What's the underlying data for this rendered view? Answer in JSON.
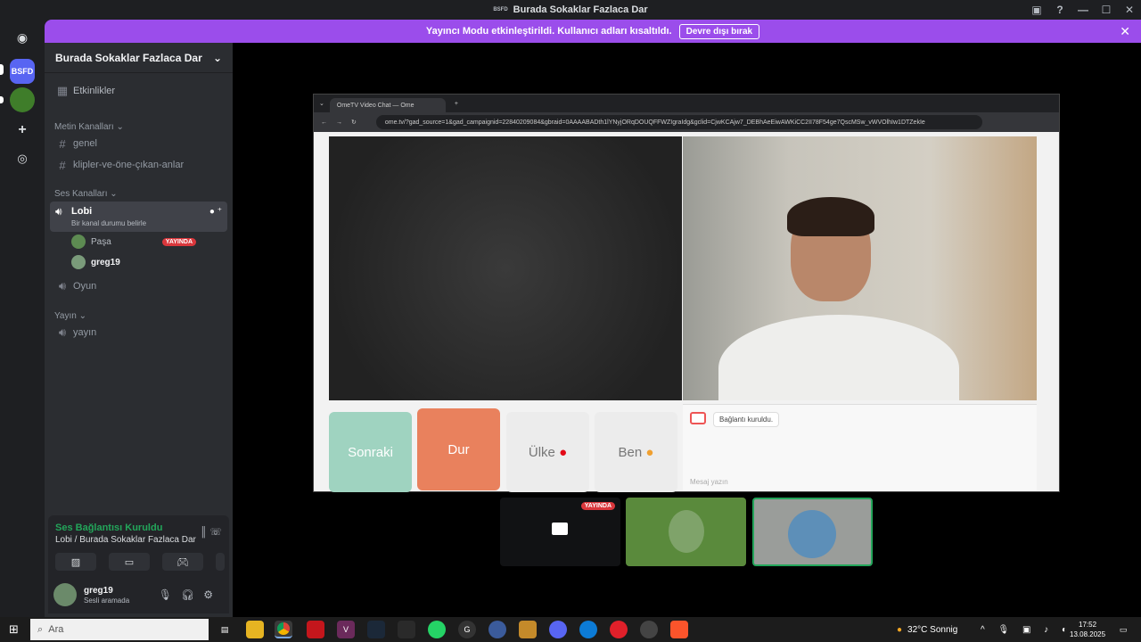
{
  "window": {
    "title": "Burada Sokaklar Fazlaca Dar",
    "badge": "BSFD"
  },
  "banner": {
    "text": "Yayıncı Modu etkinleştirildi. Kullanıcı adları kısaltıldı.",
    "button": "Devre dışı bırak"
  },
  "rail": {
    "server_badge": "BSFD"
  },
  "server": {
    "name": "Burada Sokaklar Fazlaca Dar"
  },
  "channels": {
    "events": "Etkinlikler",
    "text_category": "Metin Kanalları",
    "text": [
      "genel",
      "klipler-ve-öne-çıkan-anlar"
    ],
    "voice_category": "Ses Kanalları",
    "lobby": {
      "name": "Lobi",
      "status": "Bir kanal durumu belirle"
    },
    "lobby_users": [
      {
        "name": "Paşa",
        "badge": "YAYINDA"
      },
      {
        "name": "greg19"
      }
    ],
    "game": "Oyun",
    "stream_category": "Yayın",
    "stream": "yayın"
  },
  "voice_panel": {
    "status": "Ses Bağlantısı Kuruldu",
    "location": "Lobi / Burada Sokaklar Fazlaca Dar"
  },
  "user": {
    "name": "greg19",
    "status": "Sesli aramada"
  },
  "browser": {
    "tab": "OmeTV Video Chat — Ome",
    "url": "ome.tv/?gad_source=1&gad_campaignid=22840209084&gbraid=0AAAABADth1lYNyjORqDOUQFFWZIgraIdg&gclid=CjwKCAjw7_DEBhAeEiwAWKiCC2II78F54ge7QscMSw_vWVOlhIw1DTZekIe"
  },
  "ome": {
    "buttons": {
      "next": "Sonraki",
      "stop": "Dur",
      "country": "Ülke",
      "me": "Ben"
    },
    "chat_message": "Bağlantı kuruldu.",
    "chat_placeholder": "Mesaj yazın"
  },
  "tiles": {
    "live_badge": "YAYINDA"
  },
  "taskbar": {
    "search": "Ara",
    "weather": "32°C  Sonnig",
    "time": "17:52",
    "date": "13.08.2025"
  },
  "colors": {
    "accent": "#9b4deb",
    "live": "#da373c",
    "online": "#23a55a"
  }
}
